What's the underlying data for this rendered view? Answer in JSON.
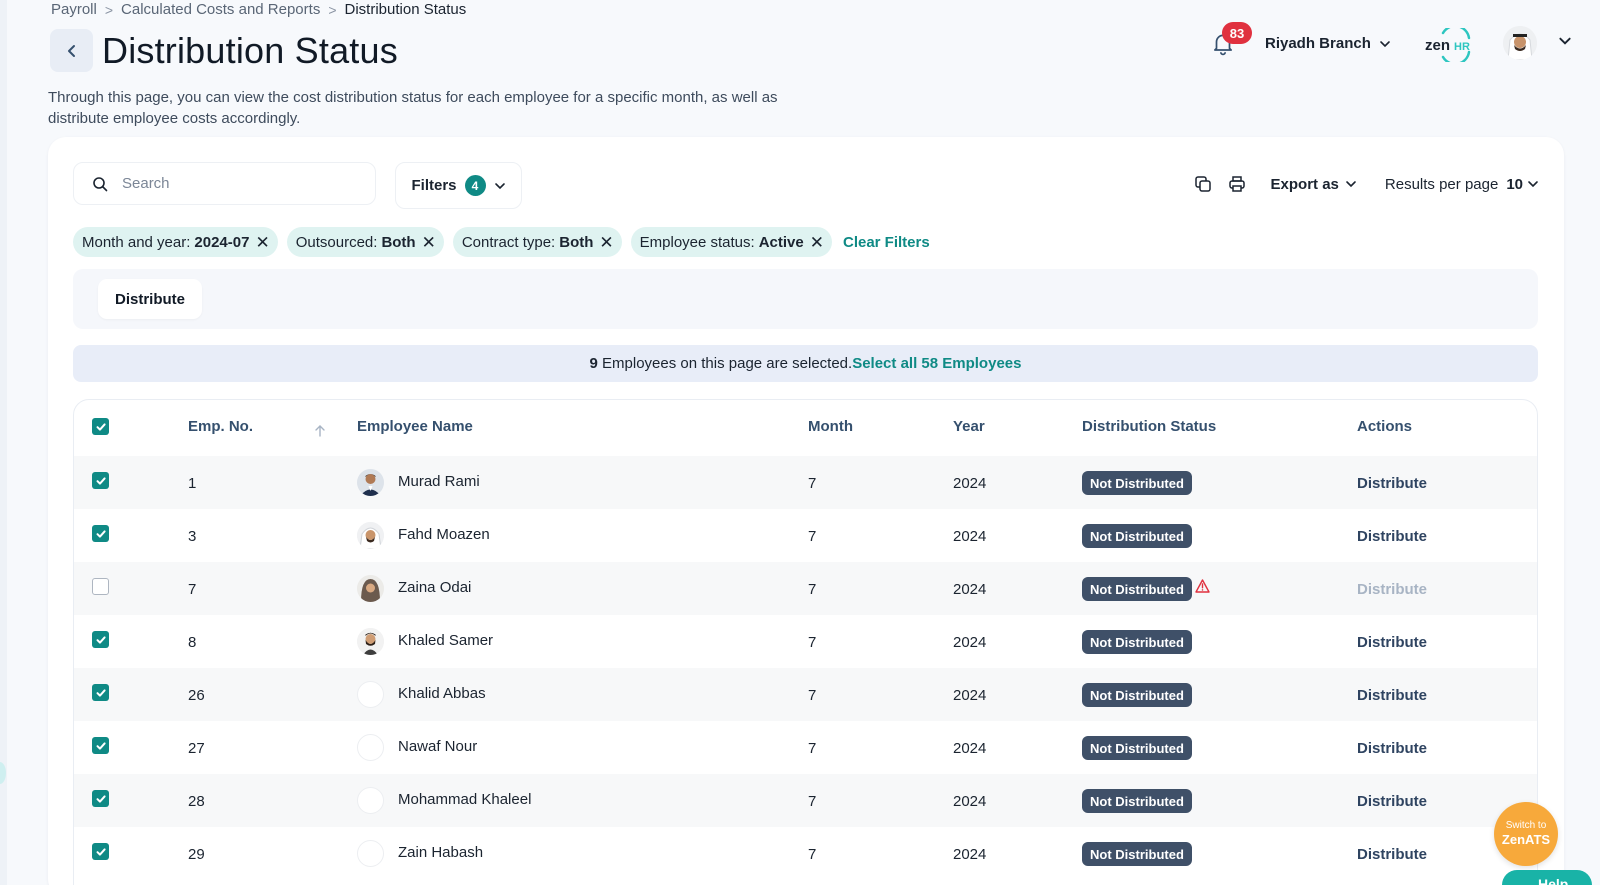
{
  "breadcrumb": {
    "items": [
      "Payroll",
      "Calculated Costs and Reports",
      "Distribution Status"
    ],
    "separator": ">"
  },
  "page": {
    "title": "Distribution Status",
    "description": "Through this page, you can view the cost distribution status for each employee for a specific month, as well as distribute employee costs accordingly."
  },
  "topbar": {
    "notification_count": "83",
    "branch": "Riyadh Branch",
    "logo_text_1": "zen",
    "logo_text_2": "HR"
  },
  "toolbar": {
    "search_placeholder": "Search",
    "filters_label": "Filters",
    "filters_count": "4",
    "export_label": "Export as",
    "results_per_page_label": "Results per page",
    "results_per_page_value": "10"
  },
  "chips": [
    {
      "label": "Month and year: ",
      "value": "2024-07"
    },
    {
      "label": "Outsourced: ",
      "value": "Both"
    },
    {
      "label": "Contract type: ",
      "value": "Both"
    },
    {
      "label": "Employee status: ",
      "value": "Active"
    }
  ],
  "clear_filters": "Clear Filters",
  "bulk": {
    "distribute_label": "Distribute"
  },
  "selection": {
    "count": "9",
    "text": " Employees on this page are selected.",
    "select_all": "Select all 58 Employees"
  },
  "table": {
    "headers": [
      "Emp. No.",
      "Employee Name",
      "Month",
      "Year",
      "Distribution Status",
      "Actions"
    ],
    "header_all_checked": true,
    "rows": [
      {
        "checked": true,
        "emp_no": "1",
        "name": "Murad Rami",
        "avatar": "suit",
        "month": "7",
        "year": "2024",
        "status": "Not Distributed",
        "warning": false,
        "action": "Distribute",
        "action_enabled": true
      },
      {
        "checked": true,
        "emp_no": "3",
        "name": "Fahd Moazen",
        "avatar": "ghutra",
        "month": "7",
        "year": "2024",
        "status": "Not Distributed",
        "warning": false,
        "action": "Distribute",
        "action_enabled": true
      },
      {
        "checked": false,
        "emp_no": "7",
        "name": "Zaina Odai",
        "avatar": "hijab",
        "month": "7",
        "year": "2024",
        "status": "Not Distributed",
        "warning": true,
        "action": "Distribute",
        "action_enabled": false
      },
      {
        "checked": true,
        "emp_no": "8",
        "name": "Khaled Samer",
        "avatar": "beard",
        "month": "7",
        "year": "2024",
        "status": "Not Distributed",
        "warning": false,
        "action": "Distribute",
        "action_enabled": true
      },
      {
        "checked": true,
        "emp_no": "26",
        "name": "Khalid Abbas",
        "avatar": "blank",
        "month": "7",
        "year": "2024",
        "status": "Not Distributed",
        "warning": false,
        "action": "Distribute",
        "action_enabled": true
      },
      {
        "checked": true,
        "emp_no": "27",
        "name": "Nawaf Nour",
        "avatar": "blank",
        "month": "7",
        "year": "2024",
        "status": "Not Distributed",
        "warning": false,
        "action": "Distribute",
        "action_enabled": true
      },
      {
        "checked": true,
        "emp_no": "28",
        "name": "Mohammad Khaleel",
        "avatar": "blank",
        "month": "7",
        "year": "2024",
        "status": "Not Distributed",
        "warning": false,
        "action": "Distribute",
        "action_enabled": true
      },
      {
        "checked": true,
        "emp_no": "29",
        "name": "Zain Habash",
        "avatar": "blank",
        "month": "7",
        "year": "2024",
        "status": "Not Distributed",
        "warning": false,
        "action": "Distribute",
        "action_enabled": true
      }
    ]
  },
  "floating": {
    "switch_line1": "Switch to",
    "switch_line2": "ZenATS",
    "help": "Help"
  },
  "colors": {
    "accent": "#0f8a85",
    "status_badge": "#3f5068",
    "notification": "#e0313f",
    "zenats": "#f7a93b"
  }
}
